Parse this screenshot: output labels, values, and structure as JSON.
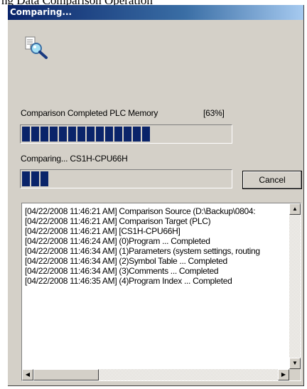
{
  "top_strip": {
    "text": "ng Data Comparison Operation"
  },
  "dialog": {
    "title": "Comparing..."
  },
  "status": {
    "memory_label": "Comparison Completed PLC Memory",
    "percent": "[63%]",
    "overall_progress": 0.63,
    "comparing_label": "Comparing... CS1H-CPU66H",
    "current_progress": 0.12
  },
  "buttons": {
    "cancel": "Cancel"
  },
  "log": {
    "lines": [
      "[04/22/2008 11:46:21 AM] Comparison Source (D:\\Backup\\0804:",
      "[04/22/2008 11:46:21 AM] Comparison Target (PLC)",
      "[04/22/2008 11:46:21 AM] [CS1H-CPU66H]",
      "[04/22/2008 11:46:24 AM]   (0)Program   ... Completed",
      "[04/22/2008 11:46:34 AM]   (1)Parameters (system settings, routing",
      "[04/22/2008 11:46:34 AM]   (2)Symbol Table   ... Completed",
      "[04/22/2008 11:46:34 AM]   (3)Comments   ... Completed",
      "[04/22/2008 11:46:35 AM]   (4)Program Index   ... Completed"
    ]
  },
  "icons": {
    "dialog_icon": "document-magnifier-icon"
  }
}
